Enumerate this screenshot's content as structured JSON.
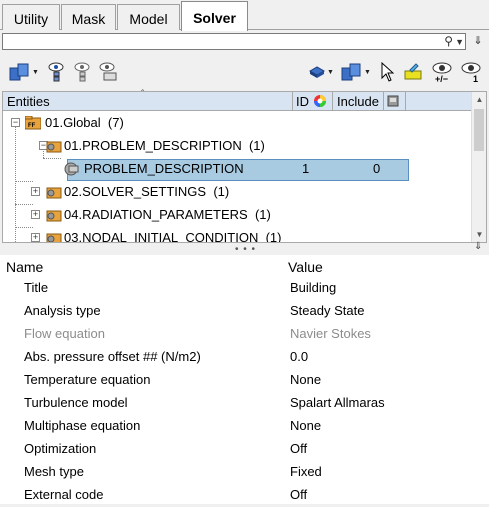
{
  "tabs": [
    {
      "label": "Utility",
      "active": false
    },
    {
      "label": "Mask",
      "active": false
    },
    {
      "label": "Model",
      "active": false
    },
    {
      "label": "Solver",
      "active": true
    }
  ],
  "search": {
    "value": "",
    "placeholder": ""
  },
  "tree": {
    "columns": {
      "entities": "Entities",
      "id": "ID",
      "include": "Include"
    },
    "rows": [
      {
        "label": "01.Global",
        "count": "(7)",
        "icon": "global-folder-icon"
      },
      {
        "label": "01.PROBLEM_DESCRIPTION",
        "count": "(1)",
        "icon": "folder-icon"
      },
      {
        "label": "PROBLEM_DESCRIPTION",
        "id": "1",
        "include": "0",
        "icon": "entity-icon",
        "selected": true
      },
      {
        "label": "02.SOLVER_SETTINGS",
        "count": "(1)",
        "icon": "folder-icon"
      },
      {
        "label": "04.RADIATION_PARAMETERS",
        "count": "(1)",
        "icon": "folder-icon"
      },
      {
        "label": "03.NODAL_INITIAL_CONDITION",
        "count": "(1)",
        "icon": "folder-icon"
      }
    ]
  },
  "props": {
    "header_name": "Name",
    "header_value": "Value",
    "rows": [
      {
        "name": "Title",
        "value": "Building",
        "disabled": false
      },
      {
        "name": "Analysis type",
        "value": "Steady State",
        "disabled": false
      },
      {
        "name": "Flow equation",
        "value": "Navier Stokes",
        "disabled": true
      },
      {
        "name": "Abs. pressure offset ## (N/m2)",
        "value": "0.0",
        "disabled": false
      },
      {
        "name": "Temperature equation",
        "value": "None",
        "disabled": false
      },
      {
        "name": "Turbulence model",
        "value": "Spalart Allmaras",
        "disabled": false
      },
      {
        "name": "Multiphase equation",
        "value": "None",
        "disabled": false
      },
      {
        "name": "Optimization",
        "value": "Off",
        "disabled": false
      },
      {
        "name": "Mesh type",
        "value": "Fixed",
        "disabled": false
      },
      {
        "name": "External code",
        "value": "Off",
        "disabled": false
      }
    ]
  },
  "colors": {
    "header_bg": "#d9e4f2",
    "selection": "#a8cbe2",
    "folder": "#e8a33c",
    "disabled_text": "#8c8c8c"
  }
}
